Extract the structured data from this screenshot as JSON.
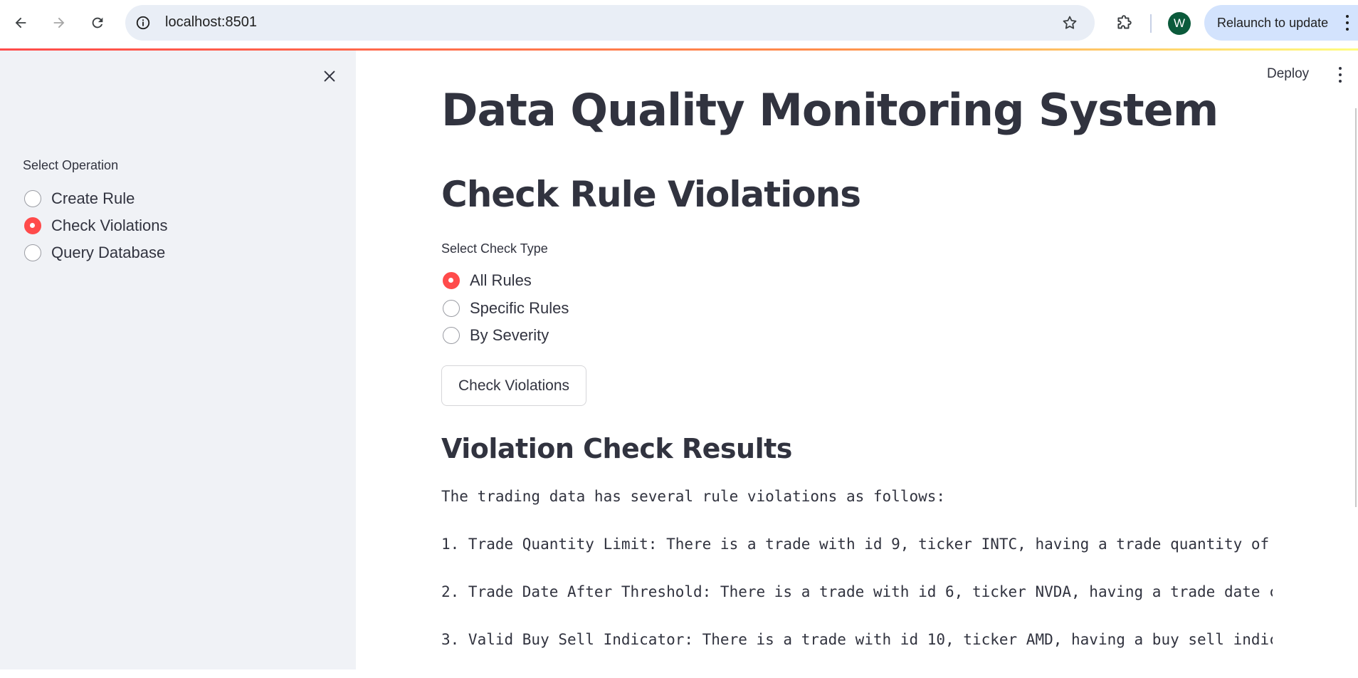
{
  "browser": {
    "url": "localhost:8501",
    "avatar_letter": "W",
    "relaunch_label": "Relaunch to update"
  },
  "sidebar": {
    "label": "Select Operation",
    "options": [
      {
        "label": "Create Rule",
        "checked": false
      },
      {
        "label": "Check Violations",
        "checked": true
      },
      {
        "label": "Query Database",
        "checked": false
      }
    ]
  },
  "toolbar": {
    "deploy_label": "Deploy"
  },
  "main": {
    "title": "Data Quality Monitoring System",
    "subtitle": "Check Rule Violations",
    "check_type_label": "Select Check Type",
    "check_types": [
      {
        "label": "All Rules",
        "checked": true
      },
      {
        "label": "Specific Rules",
        "checked": false
      },
      {
        "label": "By Severity",
        "checked": false
      }
    ],
    "button_label": "Check Violations",
    "results_heading": "Violation Check Results",
    "results_lines": [
      "The trading data has several rule violations as follows:",
      "1. Trade Quantity Limit: There is a trade with id 9, ticker INTC, having a trade quantity of",
      "2. Trade Date After Threshold: There is a trade with id 6, ticker NVDA, having a trade date c",
      "3. Valid Buy Sell Indicator: There is a trade with id 10, ticker AMD, having a buy sell indic"
    ]
  },
  "colors": {
    "accent": "#ff4b4b",
    "sidebar_bg": "#f0f2f6",
    "text": "#31333f",
    "omnibox_bg": "#e9eef6",
    "relaunch_bg": "#d3e3fd"
  }
}
